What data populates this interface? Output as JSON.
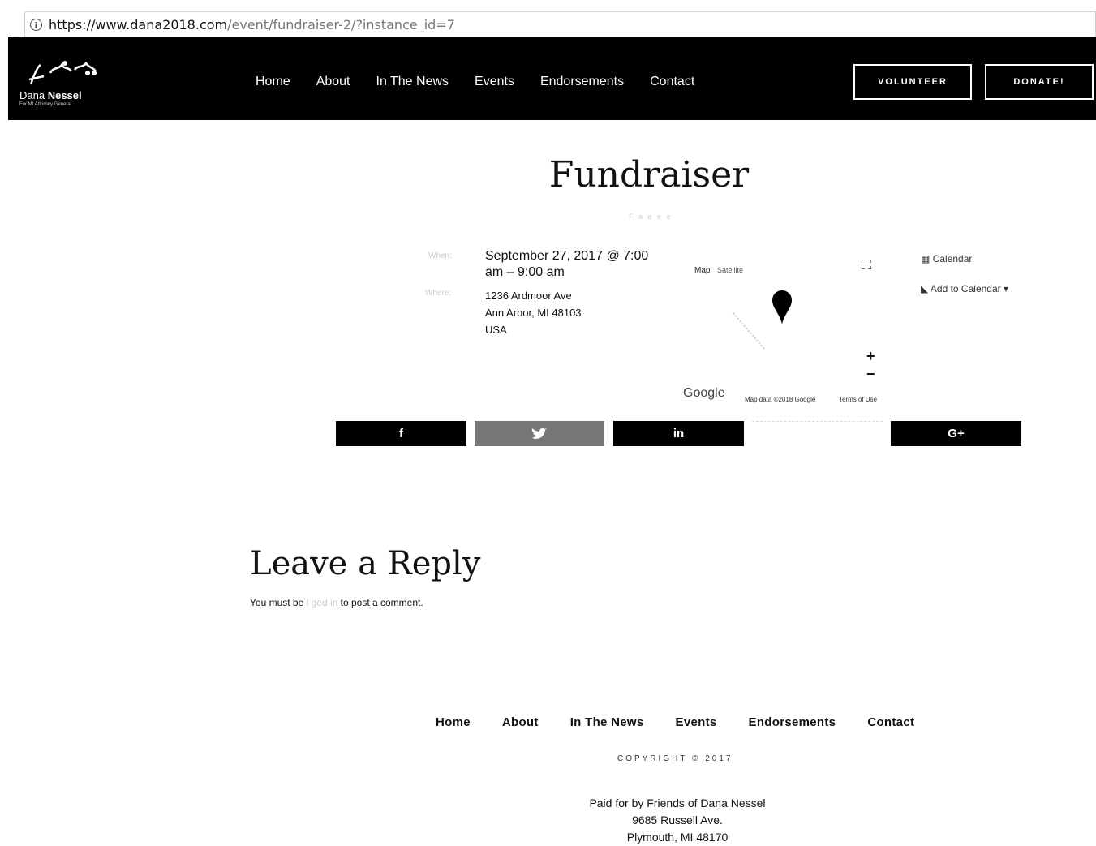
{
  "browser": {
    "url_domain": "https://www.dana2018.com",
    "url_path": "/event/fundraiser-2/?instance_id=7"
  },
  "header": {
    "logo_name_first": "Dana ",
    "logo_name_last": "Nessel",
    "logo_sub": "For MI Attorney General",
    "nav": [
      "Home",
      "About",
      "In The News",
      "Events",
      "Endorsements",
      "Contact"
    ],
    "volunteer_label": "VOLUNTEER",
    "donate_label": "DONATE!"
  },
  "event": {
    "title": "Fundraiser",
    "subtitle": "F a  e  e e",
    "when_label": "When:",
    "when": "September 27, 2017 @ 7:00 am – 9:00 am",
    "where_label": "Where:",
    "address_line1": "1236 Ardmoor Ave",
    "address_line2": "Ann Arbor, MI 48103",
    "address_line3": "USA"
  },
  "map": {
    "tab_map": "Map",
    "tab_satellite": "Satellite",
    "google": "Google",
    "map_data": "Map data ©2018 Google",
    "terms": "Terms of Use"
  },
  "calendar": {
    "calendar_label": "Calendar",
    "add_label": "Add to Calendar"
  },
  "share": {
    "facebook": "f",
    "linkedin": "in",
    "googleplus": "G+"
  },
  "reply": {
    "heading": "Leave a Reply",
    "text_before": "You must be ",
    "text_faint": "l  ged in",
    "text_after": " to post a comment."
  },
  "footer": {
    "nav": [
      "Home",
      "About",
      "In The News",
      "Events",
      "Endorsements",
      "Contact"
    ],
    "copyright": "COPYRIGHT © 2017",
    "paid_line1": "Paid for by Friends of Dana Nessel",
    "paid_line2": "9685 Russell Ave.",
    "paid_line3": "Plymouth, MI 48170"
  },
  "colors": {
    "header_bg": "#000000",
    "twitter_share": "#777777"
  }
}
